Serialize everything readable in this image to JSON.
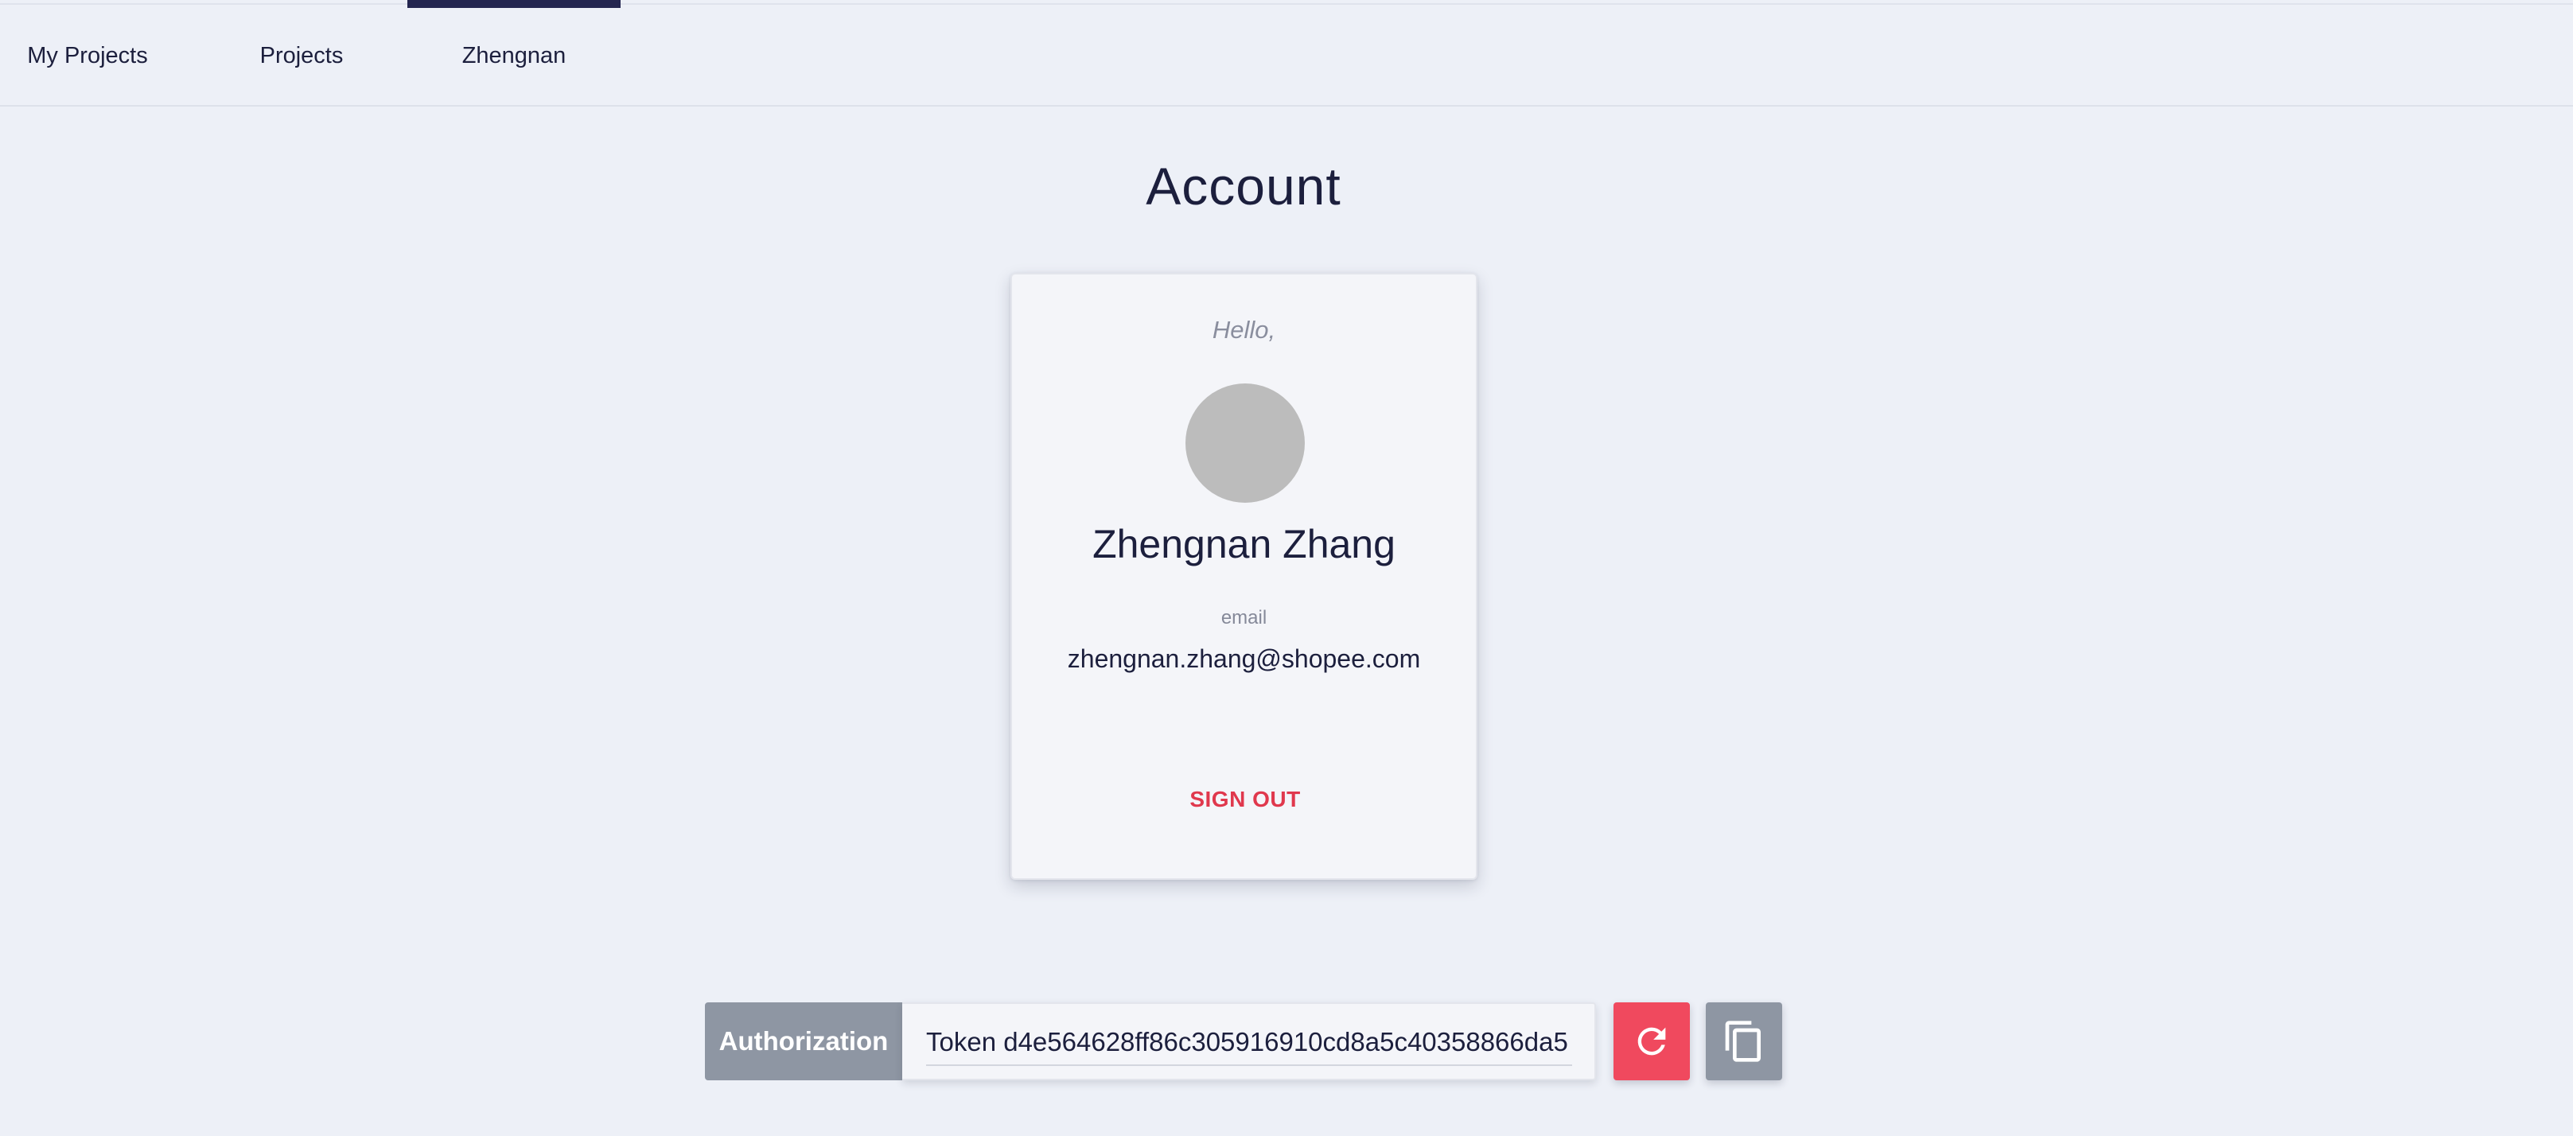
{
  "nav": {
    "items": [
      {
        "label": "My Projects"
      },
      {
        "label": "Projects"
      },
      {
        "label": "Zhengnan",
        "active": true
      }
    ]
  },
  "page": {
    "title": "Account"
  },
  "card": {
    "greeting": "Hello,",
    "name": "Zhengnan Zhang",
    "email_label": "email",
    "email": "zhengnan.zhang@shopee.com",
    "sign_out_label": "SIGN OUT"
  },
  "token": {
    "label": "Authorization",
    "value": "Token d4e564628ff86c305916910cd8a5c40358866da5",
    "refresh_icon": "refresh-icon",
    "copy_icon": "copy-icon"
  },
  "colors": {
    "background": "#edf0f7",
    "accent_nav": "#242650",
    "danger": "#e0384d",
    "refresh_button": "#f0495e",
    "neutral_button": "#8e96a3",
    "avatar_placeholder": "#bcbcbc"
  }
}
